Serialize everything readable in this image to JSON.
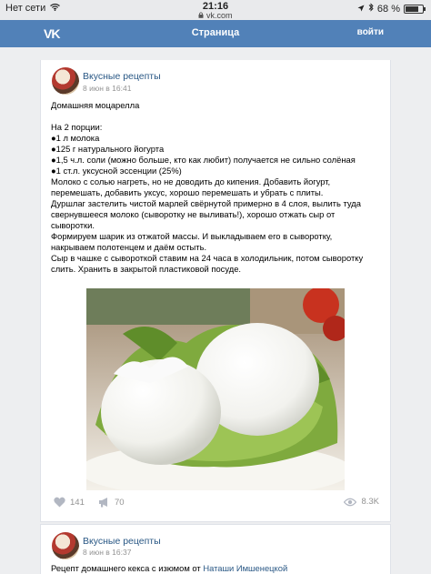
{
  "status_bar": {
    "carrier": "Нет сети",
    "time": "21:16",
    "domain": "vk.com",
    "battery": "68 %",
    "battery_level": 0.68
  },
  "navbar": {
    "logo": "VK",
    "title": "Страница",
    "login": "войти"
  },
  "posts": [
    {
      "author": "Вкусные рецепты",
      "date": "8 июн в 16:41",
      "text_lines": [
        "Домашняя моцарелла",
        "",
        "На 2 порции:",
        "●1 л молока",
        "●125 г натурального йогурта",
        "●1,5 ч.л. соли (можно больше, кто как любит) получается не сильно солёная",
        "●1 ст.л. уксусной эссенции (25%)",
        "Молоко с солью нагреть, но не доводить до кипения. Добавить йогурт,",
        "перемешать, добавить уксус, хорошо перемешать и убрать с плиты.",
        "Дуршлаг застелить чистой марлей свёрнутой примерно в 4 слоя, вылить туда",
        "свернувшееся молоко (сыворотку не выливать!), хорошо отжать сыр от",
        "сыворотки.",
        "Формируем шарик из отжатой массы. И выкладываем его в сыворотку,",
        "накрываем полотенцем и даём остыть.",
        "Сыр в чашке с сывороткой ставим на 24 часа в холодильник, потом сыворотку",
        "слить. Хранить в закрытой пластиковой посуде."
      ],
      "likes": "141",
      "reposts": "70",
      "views": "8.3K"
    },
    {
      "author": "Вкусные рецепты",
      "date": "8 июн в 16:37",
      "text_prefix": "Рецепт домашнего кекса с изюмом от ",
      "text_link": "Наташи Имшенецкой"
    }
  ],
  "colors": {
    "navbar": "#5181b8",
    "link": "#2a5885",
    "background": "#edeef0",
    "muted": "#939393"
  },
  "icons": {
    "like": "heart-icon",
    "repost": "megaphone-icon",
    "views": "eye-icon",
    "wifi": "wifi-icon",
    "lock": "lock-icon",
    "bluetooth": "bluetooth-icon",
    "location": "location-arrow-icon"
  }
}
